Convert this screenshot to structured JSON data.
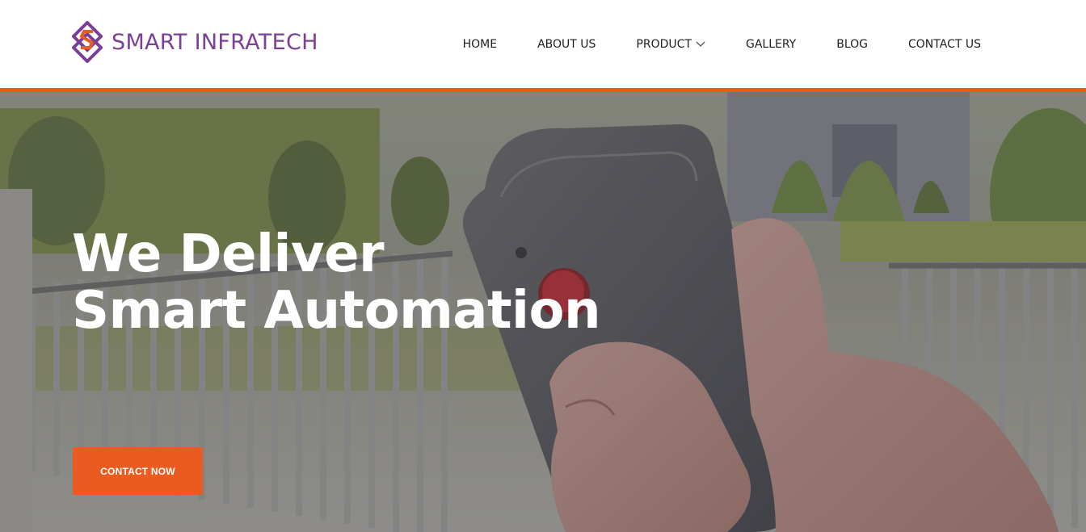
{
  "brand": {
    "name": "SMART INFRATECH",
    "logo_icon": "diamond-s-logo-icon",
    "primary_color": "#7b3f97",
    "accent_color": "#ea5b1f"
  },
  "nav": {
    "items": [
      {
        "label": "HOME"
      },
      {
        "label": "ABOUT US"
      },
      {
        "label": "PRODUCT",
        "has_dropdown": true,
        "icon": "chevron-down-icon"
      },
      {
        "label": "GALLERY"
      },
      {
        "label": "BLOG"
      },
      {
        "label": "CONTACT US"
      }
    ]
  },
  "hero": {
    "title_line1": "We Deliver",
    "title_line2": "Smart Automation",
    "cta_label": "CONTACT NOW"
  }
}
